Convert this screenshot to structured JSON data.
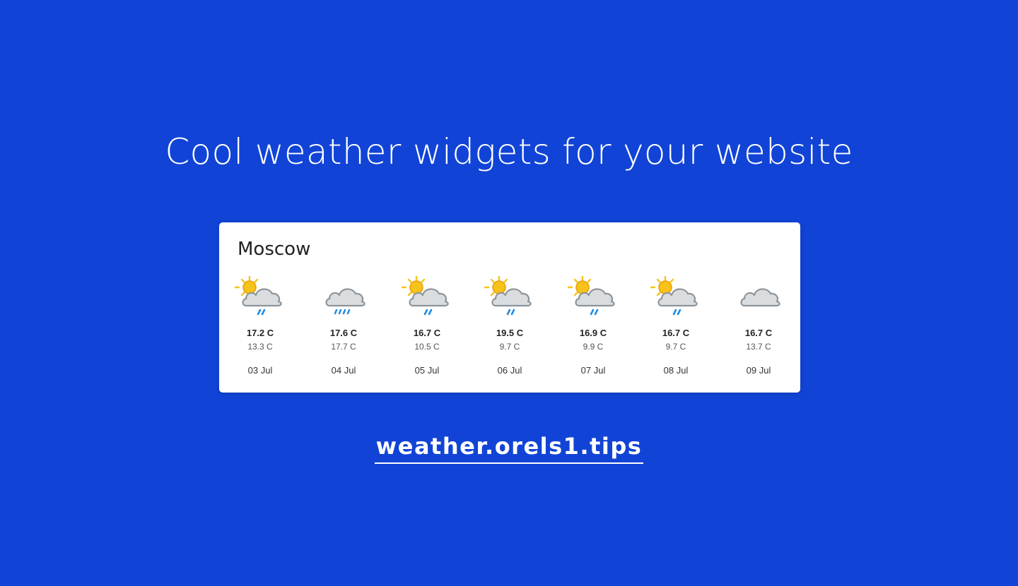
{
  "headline": "Cool weather widgets for your website",
  "widget": {
    "city": "Moscow",
    "days": [
      {
        "icon": "sun-cloud-rain-icon",
        "high": "17.2 C",
        "low": "13.3 C",
        "date": "03 Jul"
      },
      {
        "icon": "cloud-heavy-rain-icon",
        "high": "17.6 C",
        "low": "17.7 C",
        "date": "04 Jul"
      },
      {
        "icon": "sun-cloud-rain-icon",
        "high": "16.7 C",
        "low": "10.5 C",
        "date": "05 Jul"
      },
      {
        "icon": "sun-cloud-rain-icon",
        "high": "19.5 C",
        "low": "9.7 C",
        "date": "06 Jul"
      },
      {
        "icon": "sun-cloud-rain-icon",
        "high": "16.9 C",
        "low": "9.9 C",
        "date": "07 Jul"
      },
      {
        "icon": "sun-cloud-rain-icon",
        "high": "16.7 C",
        "low": "9.7 C",
        "date": "08 Jul"
      },
      {
        "icon": "cloud-icon",
        "high": "16.7 C",
        "low": "13.7 C",
        "date": "09 Jul"
      }
    ]
  },
  "link": {
    "label": "weather.orels1.tips"
  },
  "colors": {
    "background": "#1144d6",
    "sun": "#f7c21a",
    "cloud": "#d9dde0",
    "rain": "#1e8ce6"
  }
}
